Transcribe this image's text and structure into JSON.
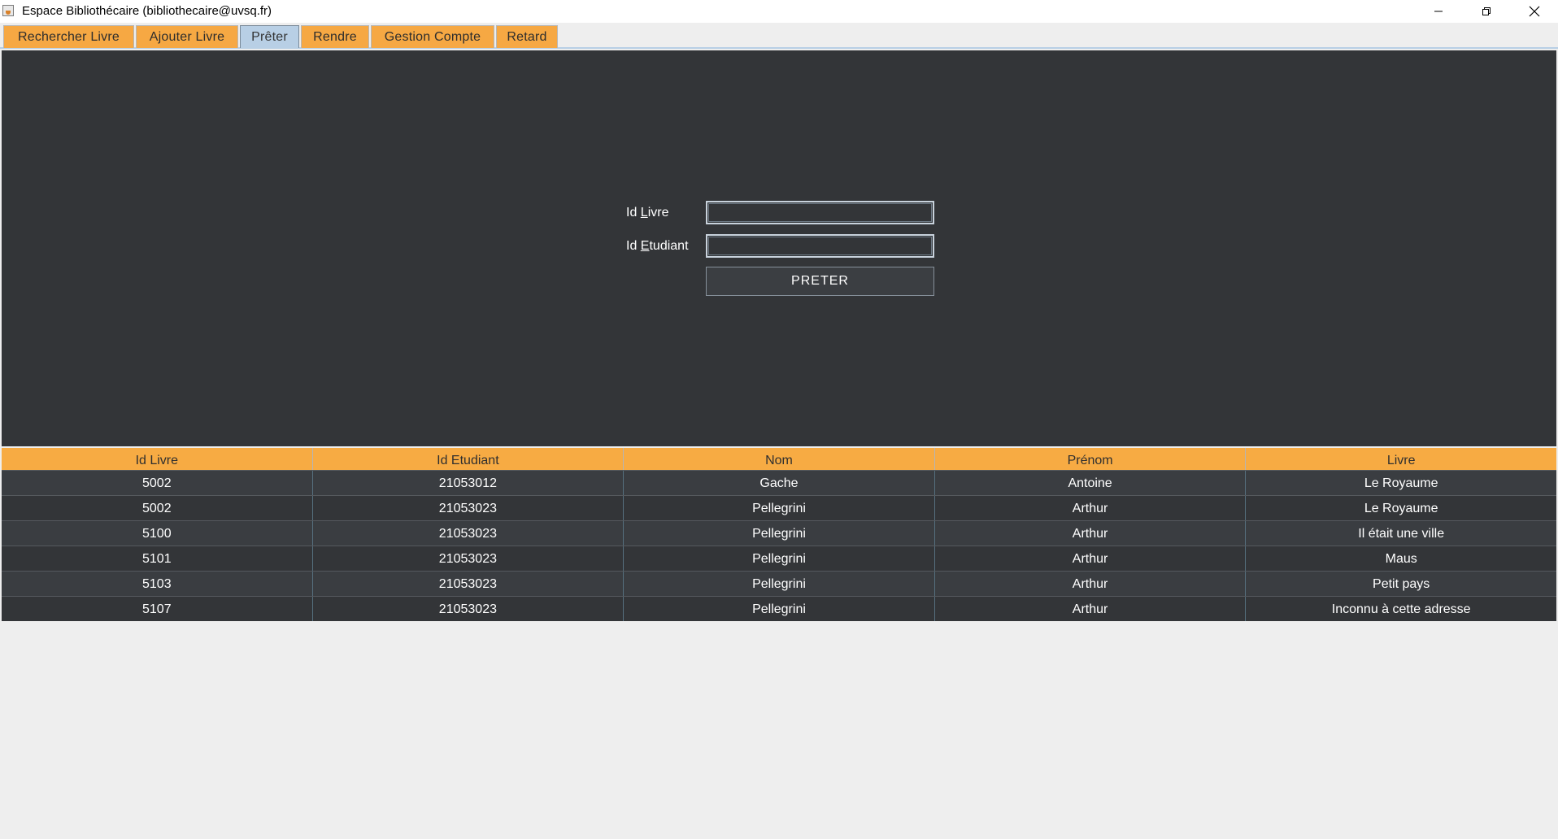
{
  "window": {
    "title": "Espace Bibliothécaire (bibliothecaire@uvsq.fr)"
  },
  "tabs": [
    {
      "label": "Rechercher Livre",
      "selected": false
    },
    {
      "label": "Ajouter Livre",
      "selected": false
    },
    {
      "label": "Prêter",
      "selected": true
    },
    {
      "label": "Rendre",
      "selected": false
    },
    {
      "label": "Gestion Compte",
      "selected": false
    },
    {
      "label": "Retard",
      "selected": false
    }
  ],
  "form": {
    "id_livre_label_mnemonic_pre": "Id ",
    "id_livre_label_mnemonic_char": "L",
    "id_livre_label_mnemonic_post": "ivre",
    "id_livre_value": "",
    "id_etudiant_label_mnemonic_pre": "Id ",
    "id_etudiant_label_mnemonic_char": "E",
    "id_etudiant_label_mnemonic_post": "tudiant",
    "id_etudiant_value": "",
    "submit_label": "PRETER"
  },
  "table": {
    "columns": [
      "Id Livre",
      "Id Etudiant",
      "Nom",
      "Prénom",
      "Livre"
    ],
    "rows": [
      [
        "5002",
        "21053012",
        "Gache",
        "Antoine",
        "Le Royaume"
      ],
      [
        "5002",
        "21053023",
        "Pellegrini",
        "Arthur",
        "Le Royaume"
      ],
      [
        "5100",
        "21053023",
        "Pellegrini",
        "Arthur",
        "Il était une ville"
      ],
      [
        "5101",
        "21053023",
        "Pellegrini",
        "Arthur",
        "Maus"
      ],
      [
        "5103",
        "21053023",
        "Pellegrini",
        "Arthur",
        "Petit pays"
      ],
      [
        "5107",
        "21053023",
        "Pellegrini",
        "Arthur",
        "Inconnu à cette adresse"
      ]
    ]
  },
  "colors": {
    "accent_orange": "#f7ab43",
    "panel_dark": "#333538",
    "selected_tab": "#b8cfe5"
  },
  "icons": {
    "app": "java-app-icon",
    "minimize": "minimize-icon",
    "restore": "restore-icon",
    "close": "close-icon"
  }
}
